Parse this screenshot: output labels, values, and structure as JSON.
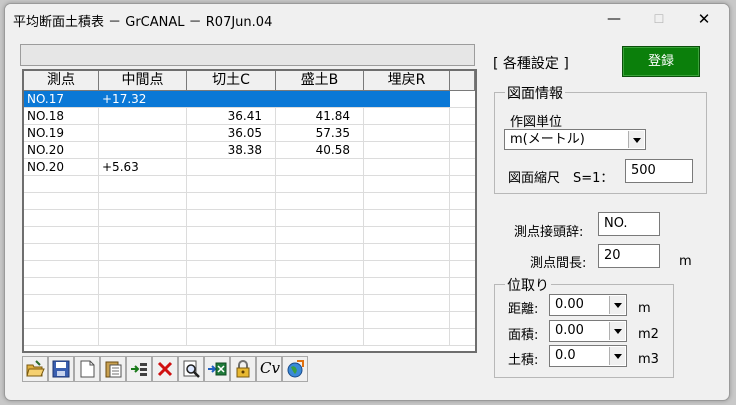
{
  "window": {
    "title": "平均断面土積表 － GrCANAL － R07Jun.04",
    "minimize_glyph": "—",
    "maximize_glyph": "☐",
    "close_glyph": "✕"
  },
  "table": {
    "headers": [
      "測点",
      "中間点",
      "切土C",
      "盛土B",
      "埋戻R"
    ],
    "rows": [
      {
        "station": "NO.17",
        "intermediate": "+17.32",
        "cut": "",
        "fill": "",
        "backfill": ""
      },
      {
        "station": "NO.18",
        "intermediate": "",
        "cut": "36.41",
        "fill": "41.84",
        "backfill": ""
      },
      {
        "station": "NO.19",
        "intermediate": "",
        "cut": "36.05",
        "fill": "57.35",
        "backfill": ""
      },
      {
        "station": "NO.20",
        "intermediate": "",
        "cut": "38.38",
        "fill": "40.58",
        "backfill": ""
      },
      {
        "station": "NO.20",
        "intermediate": "+5.63",
        "cut": "",
        "fill": "",
        "backfill": ""
      }
    ]
  },
  "settings": {
    "section_title": "[ 各種設定 ]",
    "register_label": "登録",
    "drawing_info": {
      "group_label": "図面情報",
      "unit_label": "作図単位",
      "unit_value": "m(メートル)",
      "scale_label": "図面縮尺　S=1：",
      "scale_value": "500"
    },
    "station_prefix_label": "測点接頭辞:",
    "station_prefix_value": "NO.",
    "station_interval_label": "測点間長:",
    "station_interval_value": "20",
    "station_interval_unit": "m",
    "rounding": {
      "group_label": "位取り",
      "distance_label": "距離:",
      "distance_value": "0.00",
      "distance_unit": "m",
      "area_label": "面積:",
      "area_value": "0.00",
      "area_unit": "m2",
      "volume_label": "土積:",
      "volume_value": "0.0",
      "volume_unit": "m3"
    }
  },
  "toolbar_icons": [
    "open-folder-icon",
    "save-icon",
    "new-file-icon",
    "paste-icon",
    "insert-row-icon",
    "delete-icon",
    "preview-icon",
    "excel-export-icon",
    "lock-icon",
    "cv-icon",
    "web-icon"
  ],
  "cv_text": "Cv",
  "accent_colors": {
    "selection": "#0a78d6",
    "register_button": "#0b7f0b"
  }
}
